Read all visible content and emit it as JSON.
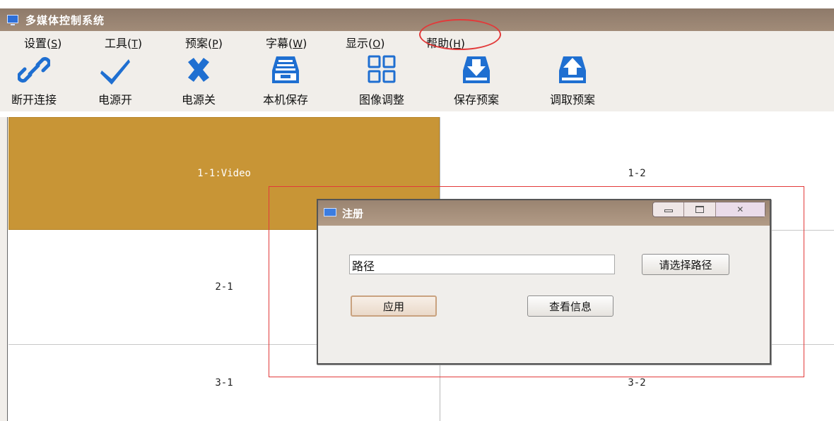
{
  "window": {
    "title": "多媒体控制系统"
  },
  "menu": [
    {
      "label": "设置",
      "accel": "S"
    },
    {
      "label": "工具",
      "accel": "T"
    },
    {
      "label": "预案",
      "accel": "P"
    },
    {
      "label": "字幕",
      "accel": "W"
    },
    {
      "label": "显示",
      "accel": "O"
    },
    {
      "label": "帮助",
      "accel": "H"
    }
  ],
  "toolbar": [
    {
      "label": "断开连接",
      "icon": "link-icon"
    },
    {
      "label": "电源开",
      "icon": "checkmark-icon"
    },
    {
      "label": "电源关",
      "icon": "x-icon"
    },
    {
      "label": "本机保存",
      "icon": "inbox-save-icon"
    },
    {
      "label": "图像调整",
      "icon": "grid-icon"
    },
    {
      "label": "保存预案",
      "icon": "download-tray-icon"
    },
    {
      "label": "调取预案",
      "icon": "upload-tray-icon"
    }
  ],
  "grid": {
    "cells": [
      "1-1:Video",
      "1-2",
      "2-1",
      "3-1",
      "3-2"
    ],
    "active_color": "#c89536"
  },
  "dialog": {
    "title": "注册",
    "path_value": "路径",
    "browse_button": "请选择路径",
    "apply_button": "应用",
    "view_info_button": "查看信息"
  },
  "colors": {
    "highlight": "#e23a3a",
    "titlebar": "#9a8471"
  }
}
